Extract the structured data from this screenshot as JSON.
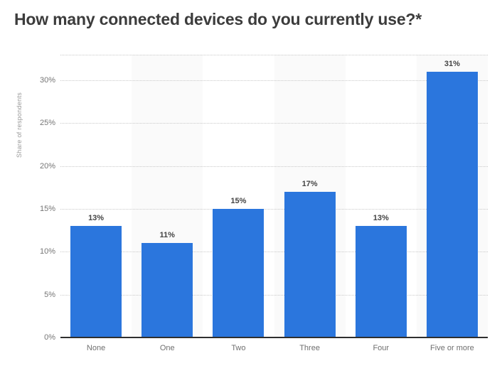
{
  "chart_data": {
    "type": "bar",
    "title": "How many connected devices do you currently use?*",
    "xlabel": "",
    "ylabel": "Share of respondents",
    "categories": [
      "None",
      "One",
      "Two",
      "Three",
      "Four",
      "Five or more"
    ],
    "values": [
      13,
      11,
      15,
      17,
      13,
      31
    ],
    "value_labels": [
      "13%",
      "11%",
      "15%",
      "17%",
      "13%",
      "31%"
    ],
    "ylim": [
      0,
      33
    ],
    "yticks": [
      0,
      5,
      10,
      15,
      20,
      25,
      30
    ],
    "ytick_labels": [
      "0%",
      "5%",
      "10%",
      "15%",
      "20%",
      "25%",
      "30%"
    ],
    "grid": true,
    "legend": "none",
    "series": [
      {
        "name": "Share of respondents",
        "values": [
          13,
          11,
          15,
          17,
          13,
          31
        ],
        "color": "#2b76dd"
      }
    ],
    "colors": {
      "bar": "#2b76dd",
      "title": "#3c3c3c",
      "tick": "#757575",
      "axis_title": "#9a9a9a",
      "gridline": "#c9c9c9",
      "baseline": "#2f2f2f",
      "band": "#fafafa",
      "background": "#ffffff",
      "value_label": "#444444"
    }
  }
}
